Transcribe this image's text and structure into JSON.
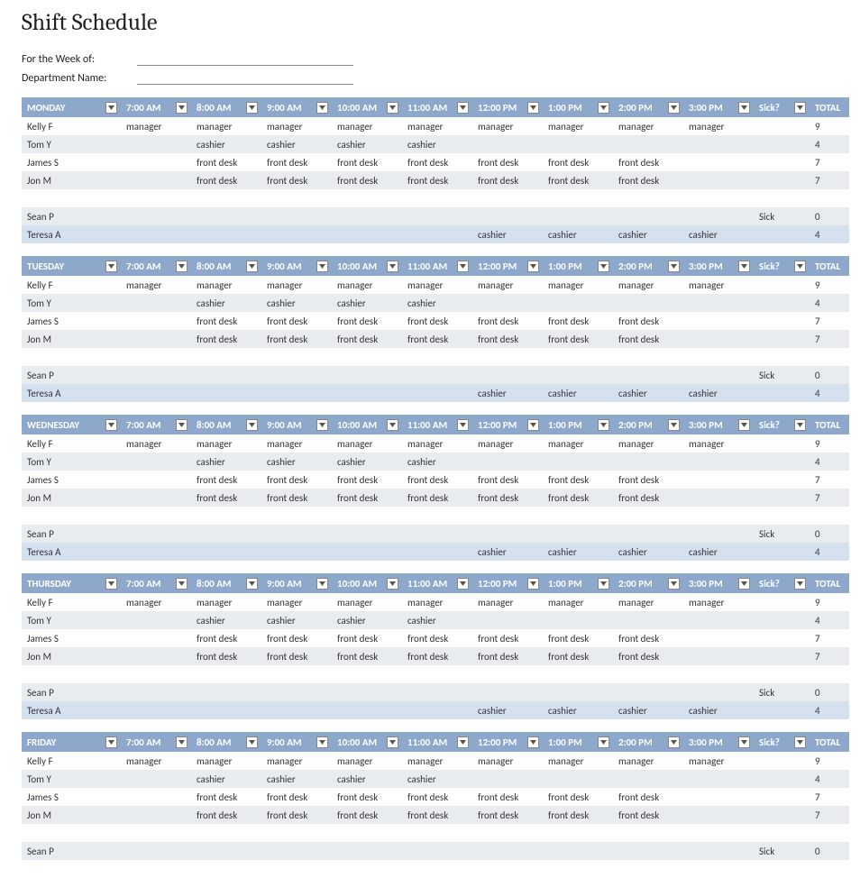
{
  "title": "Shift Schedule",
  "meta": {
    "week_label": "For the Week of:",
    "dept_label": "Department Name:"
  },
  "header_cols": [
    "7:00 AM",
    "8:00 AM",
    "9:00 AM",
    "10:00 AM",
    "11:00 AM",
    "12:00 PM",
    "1:00 PM",
    "2:00 PM",
    "3:00 PM",
    "Sick?",
    "TOTAL"
  ],
  "days": [
    {
      "name": "MONDAY",
      "rows": [
        {
          "n": "Kelly F",
          "c": [
            "manager",
            "manager",
            "manager",
            "manager",
            "manager",
            "manager",
            "manager",
            "manager",
            "manager",
            "",
            "9"
          ],
          "s": "odd"
        },
        {
          "n": "Tom Y",
          "c": [
            "",
            "cashier",
            "cashier",
            "cashier",
            "cashier",
            "",
            "",
            "",
            "",
            "",
            "4"
          ],
          "s": "even"
        },
        {
          "n": "James S",
          "c": [
            "",
            "front desk",
            "front desk",
            "front desk",
            "front desk",
            "front desk",
            "front desk",
            "front desk",
            "",
            "",
            "7"
          ],
          "s": "odd"
        },
        {
          "n": "Jon M",
          "c": [
            "",
            "front desk",
            "front desk",
            "front desk",
            "front desk",
            "front desk",
            "front desk",
            "front desk",
            "",
            "",
            "7"
          ],
          "s": "even"
        },
        {
          "n": "",
          "c": [
            "",
            "",
            "",
            "",
            "",
            "",
            "",
            "",
            "",
            "",
            ""
          ],
          "s": "gap"
        },
        {
          "n": "Sean P",
          "c": [
            "",
            "",
            "",
            "",
            "",
            "",
            "",
            "",
            "",
            "Sick",
            "0"
          ],
          "s": "even"
        },
        {
          "n": "Teresa A",
          "c": [
            "",
            "",
            "",
            "",
            "",
            "cashier",
            "cashier",
            "cashier",
            "cashier",
            "",
            "4"
          ],
          "s": "blue"
        }
      ]
    },
    {
      "name": "TUESDAY",
      "rows": [
        {
          "n": "Kelly F",
          "c": [
            "manager",
            "manager",
            "manager",
            "manager",
            "manager",
            "manager",
            "manager",
            "manager",
            "manager",
            "",
            "9"
          ],
          "s": "odd"
        },
        {
          "n": "Tom Y",
          "c": [
            "",
            "cashier",
            "cashier",
            "cashier",
            "cashier",
            "",
            "",
            "",
            "",
            "",
            "4"
          ],
          "s": "even"
        },
        {
          "n": "James S",
          "c": [
            "",
            "front desk",
            "front desk",
            "front desk",
            "front desk",
            "front desk",
            "front desk",
            "front desk",
            "",
            "",
            "7"
          ],
          "s": "odd"
        },
        {
          "n": "Jon M",
          "c": [
            "",
            "front desk",
            "front desk",
            "front desk",
            "front desk",
            "front desk",
            "front desk",
            "front desk",
            "",
            "",
            "7"
          ],
          "s": "even"
        },
        {
          "n": "",
          "c": [
            "",
            "",
            "",
            "",
            "",
            "",
            "",
            "",
            "",
            "",
            ""
          ],
          "s": "gap"
        },
        {
          "n": "Sean P",
          "c": [
            "",
            "",
            "",
            "",
            "",
            "",
            "",
            "",
            "",
            "Sick",
            "0"
          ],
          "s": "even"
        },
        {
          "n": "Teresa A",
          "c": [
            "",
            "",
            "",
            "",
            "",
            "cashier",
            "cashier",
            "cashier",
            "cashier",
            "",
            "4"
          ],
          "s": "blue"
        }
      ]
    },
    {
      "name": "WEDNESDAY",
      "rows": [
        {
          "n": "Kelly F",
          "c": [
            "manager",
            "manager",
            "manager",
            "manager",
            "manager",
            "manager",
            "manager",
            "manager",
            "manager",
            "",
            "9"
          ],
          "s": "odd"
        },
        {
          "n": "Tom Y",
          "c": [
            "",
            "cashier",
            "cashier",
            "cashier",
            "cashier",
            "",
            "",
            "",
            "",
            "",
            "4"
          ],
          "s": "even"
        },
        {
          "n": "James S",
          "c": [
            "",
            "front desk",
            "front desk",
            "front desk",
            "front desk",
            "front desk",
            "front desk",
            "front desk",
            "",
            "",
            "7"
          ],
          "s": "odd"
        },
        {
          "n": "Jon M",
          "c": [
            "",
            "front desk",
            "front desk",
            "front desk",
            "front desk",
            "front desk",
            "front desk",
            "front desk",
            "",
            "",
            "7"
          ],
          "s": "even"
        },
        {
          "n": "",
          "c": [
            "",
            "",
            "",
            "",
            "",
            "",
            "",
            "",
            "",
            "",
            ""
          ],
          "s": "gap"
        },
        {
          "n": "Sean P",
          "c": [
            "",
            "",
            "",
            "",
            "",
            "",
            "",
            "",
            "",
            "Sick",
            "0"
          ],
          "s": "even"
        },
        {
          "n": "Teresa A",
          "c": [
            "",
            "",
            "",
            "",
            "",
            "cashier",
            "cashier",
            "cashier",
            "cashier",
            "",
            "4"
          ],
          "s": "blue"
        }
      ]
    },
    {
      "name": "THURSDAY",
      "rows": [
        {
          "n": "Kelly F",
          "c": [
            "manager",
            "manager",
            "manager",
            "manager",
            "manager",
            "manager",
            "manager",
            "manager",
            "manager",
            "",
            "9"
          ],
          "s": "odd"
        },
        {
          "n": "Tom Y",
          "c": [
            "",
            "cashier",
            "cashier",
            "cashier",
            "cashier",
            "",
            "",
            "",
            "",
            "",
            "4"
          ],
          "s": "even"
        },
        {
          "n": "James S",
          "c": [
            "",
            "front desk",
            "front desk",
            "front desk",
            "front desk",
            "front desk",
            "front desk",
            "front desk",
            "",
            "",
            "7"
          ],
          "s": "odd"
        },
        {
          "n": "Jon M",
          "c": [
            "",
            "front desk",
            "front desk",
            "front desk",
            "front desk",
            "front desk",
            "front desk",
            "front desk",
            "",
            "",
            "7"
          ],
          "s": "even"
        },
        {
          "n": "",
          "c": [
            "",
            "",
            "",
            "",
            "",
            "",
            "",
            "",
            "",
            "",
            ""
          ],
          "s": "gap"
        },
        {
          "n": "Sean P",
          "c": [
            "",
            "",
            "",
            "",
            "",
            "",
            "",
            "",
            "",
            "Sick",
            "0"
          ],
          "s": "even"
        },
        {
          "n": "Teresa A",
          "c": [
            "",
            "",
            "",
            "",
            "",
            "cashier",
            "cashier",
            "cashier",
            "cashier",
            "",
            "4"
          ],
          "s": "blue"
        }
      ]
    },
    {
      "name": "FRIDAY",
      "rows": [
        {
          "n": "Kelly F",
          "c": [
            "manager",
            "manager",
            "manager",
            "manager",
            "manager",
            "manager",
            "manager",
            "manager",
            "manager",
            "",
            "9"
          ],
          "s": "odd"
        },
        {
          "n": "Tom Y",
          "c": [
            "",
            "cashier",
            "cashier",
            "cashier",
            "cashier",
            "",
            "",
            "",
            "",
            "",
            "4"
          ],
          "s": "even"
        },
        {
          "n": "James S",
          "c": [
            "",
            "front desk",
            "front desk",
            "front desk",
            "front desk",
            "front desk",
            "front desk",
            "front desk",
            "",
            "",
            "7"
          ],
          "s": "odd"
        },
        {
          "n": "Jon M",
          "c": [
            "",
            "front desk",
            "front desk",
            "front desk",
            "front desk",
            "front desk",
            "front desk",
            "front desk",
            "",
            "",
            "7"
          ],
          "s": "even"
        },
        {
          "n": "",
          "c": [
            "",
            "",
            "",
            "",
            "",
            "",
            "",
            "",
            "",
            "",
            ""
          ],
          "s": "gap"
        },
        {
          "n": "Sean P",
          "c": [
            "",
            "",
            "",
            "",
            "",
            "",
            "",
            "",
            "",
            "Sick",
            "0"
          ],
          "s": "even"
        }
      ]
    }
  ]
}
